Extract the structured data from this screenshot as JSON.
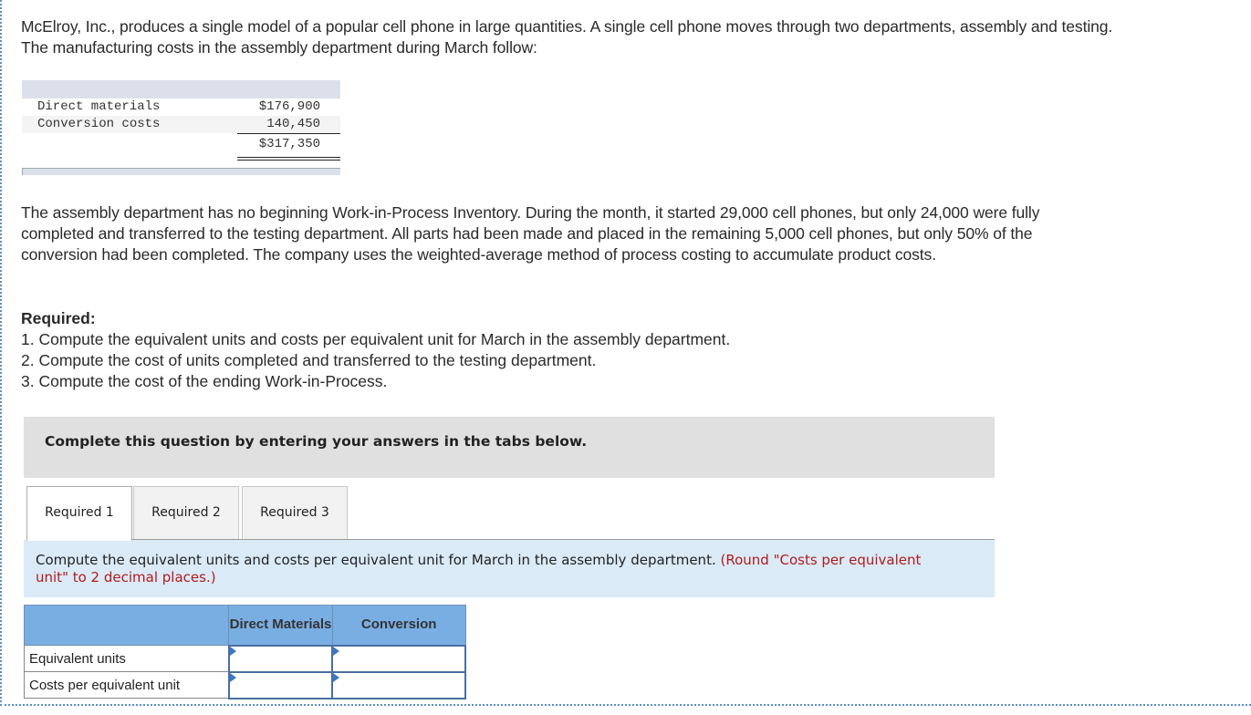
{
  "problem": {
    "intro": "McElroy, Inc., produces a single model of a popular cell phone in large quantities. A single cell phone moves through two departments, assembly and testing. The manufacturing costs in the assembly department during March follow:",
    "cost_table": {
      "rows": [
        {
          "label": "Direct materials",
          "value": "$176,900"
        },
        {
          "label": "Conversion costs",
          "value": "140,450"
        }
      ],
      "total": "$317,350"
    },
    "scenario": "The assembly department has no beginning Work-in-Process Inventory. During the month, it started 29,000 cell phones, but only 24,000 were fully completed and transferred to the testing department. All parts had been made and placed in the remaining 5,000 cell phones, but only 50% of the conversion had been completed. The company uses the weighted-average method of process costing to accumulate product costs.",
    "required_heading": "Required:",
    "required_items": [
      "1. Compute the equivalent units and costs per equivalent unit for March in the assembly department.",
      "2. Compute the cost of units completed and transferred to the testing department.",
      "3. Compute the cost of the ending Work-in-Process."
    ]
  },
  "instruction_bar": "Complete this question by entering your answers in the tabs below.",
  "tabs": [
    {
      "label": "Required 1",
      "active": true
    },
    {
      "label": "Required 2",
      "active": false
    },
    {
      "label": "Required 3",
      "active": false
    }
  ],
  "prompt": {
    "text": "Compute the equivalent units and costs per equivalent unit for March in the assembly department.",
    "note": "(Round \"Costs per equivalent unit\" to 2 decimal places.)"
  },
  "answer_table": {
    "headers": [
      "",
      "Direct Materials",
      "Conversion"
    ],
    "rows": [
      {
        "label": "Equivalent units",
        "direct_materials": "",
        "conversion": ""
      },
      {
        "label": "Costs per equivalent unit",
        "direct_materials": "",
        "conversion": ""
      }
    ]
  },
  "colors": {
    "header_blue": "#79aee3",
    "prompt_bg": "#daeaf7",
    "note_red": "#b01c1c",
    "instruction_bg": "#e0e0e0"
  }
}
